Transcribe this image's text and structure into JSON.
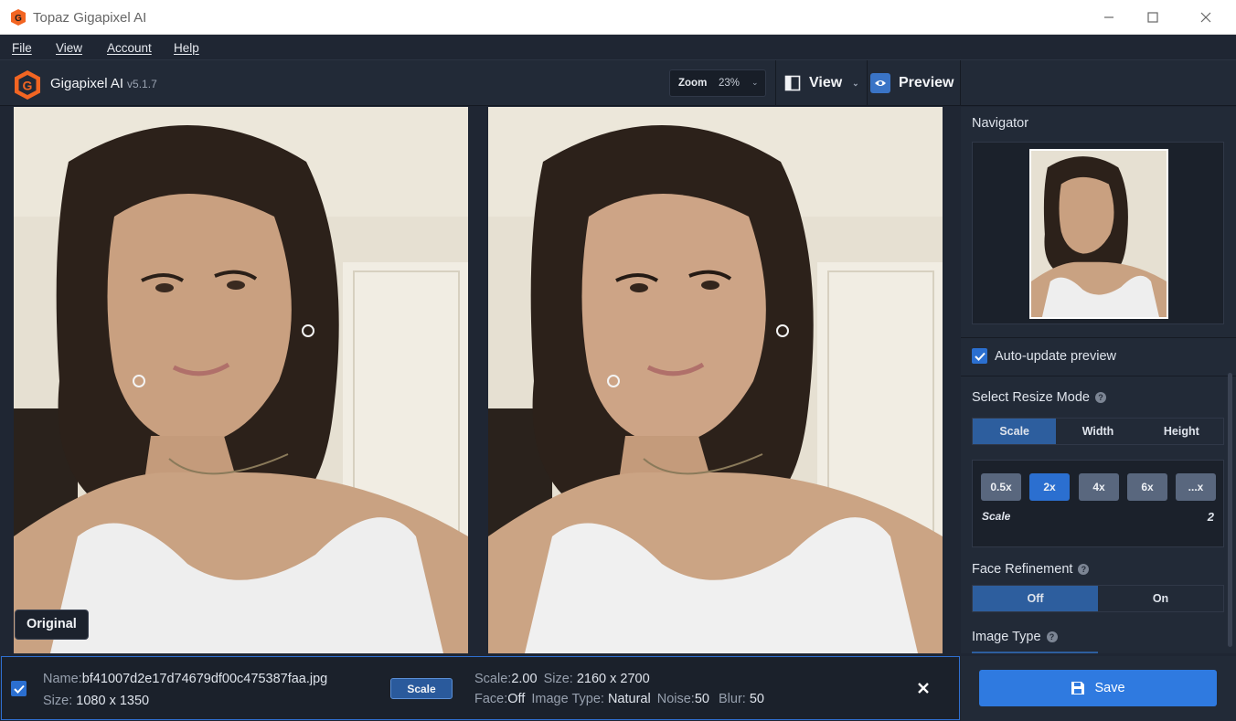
{
  "window": {
    "title": "Topaz Gigapixel AI"
  },
  "menu": {
    "file": "File",
    "view": "View",
    "account": "Account",
    "help": "Help"
  },
  "toolbar": {
    "brand": "Gigapixel AI",
    "version": "v5.1.7",
    "zoom_label": "Zoom",
    "zoom_value": "23%",
    "view_label": "View",
    "preview_label": "Preview"
  },
  "canvas": {
    "original_label": "Original"
  },
  "panel": {
    "navigator_title": "Navigator",
    "auto_update_label": "Auto-update preview",
    "auto_update_checked": true,
    "resize_mode_title": "Select Resize Mode",
    "resize_modes": [
      "Scale",
      "Width",
      "Height"
    ],
    "resize_mode_selected": "Scale",
    "scale_options": [
      "0.5x",
      "2x",
      "4x",
      "6x",
      "...x"
    ],
    "scale_selected": "2x",
    "scale_label": "Scale",
    "scale_value": "2",
    "face_refinement_title": "Face Refinement",
    "face_options": [
      "Off",
      "On"
    ],
    "face_selected": "Off",
    "image_type_title": "Image Type"
  },
  "file": {
    "checked": true,
    "name_key": "Name:",
    "name": "bf41007d2e17d74679df00c475387faa.jpg",
    "size_key": "Size:",
    "size": "1080 x 1350",
    "mode_tag": "Scale",
    "scale_key": "Scale:",
    "scale": "2.00",
    "out_size_key": "Size:",
    "out_size": "2160 x 2700",
    "face_key": "Face:",
    "face": "Off",
    "image_type_key": "Image Type:",
    "image_type": "Natural",
    "noise_key": "Noise:",
    "noise": "50",
    "blur_key": "Blur:",
    "blur": "50"
  },
  "actions": {
    "save_label": "Save"
  },
  "colors": {
    "accent": "#2f7ae0",
    "selected": "#2d5e9e",
    "background": "#222a37"
  }
}
